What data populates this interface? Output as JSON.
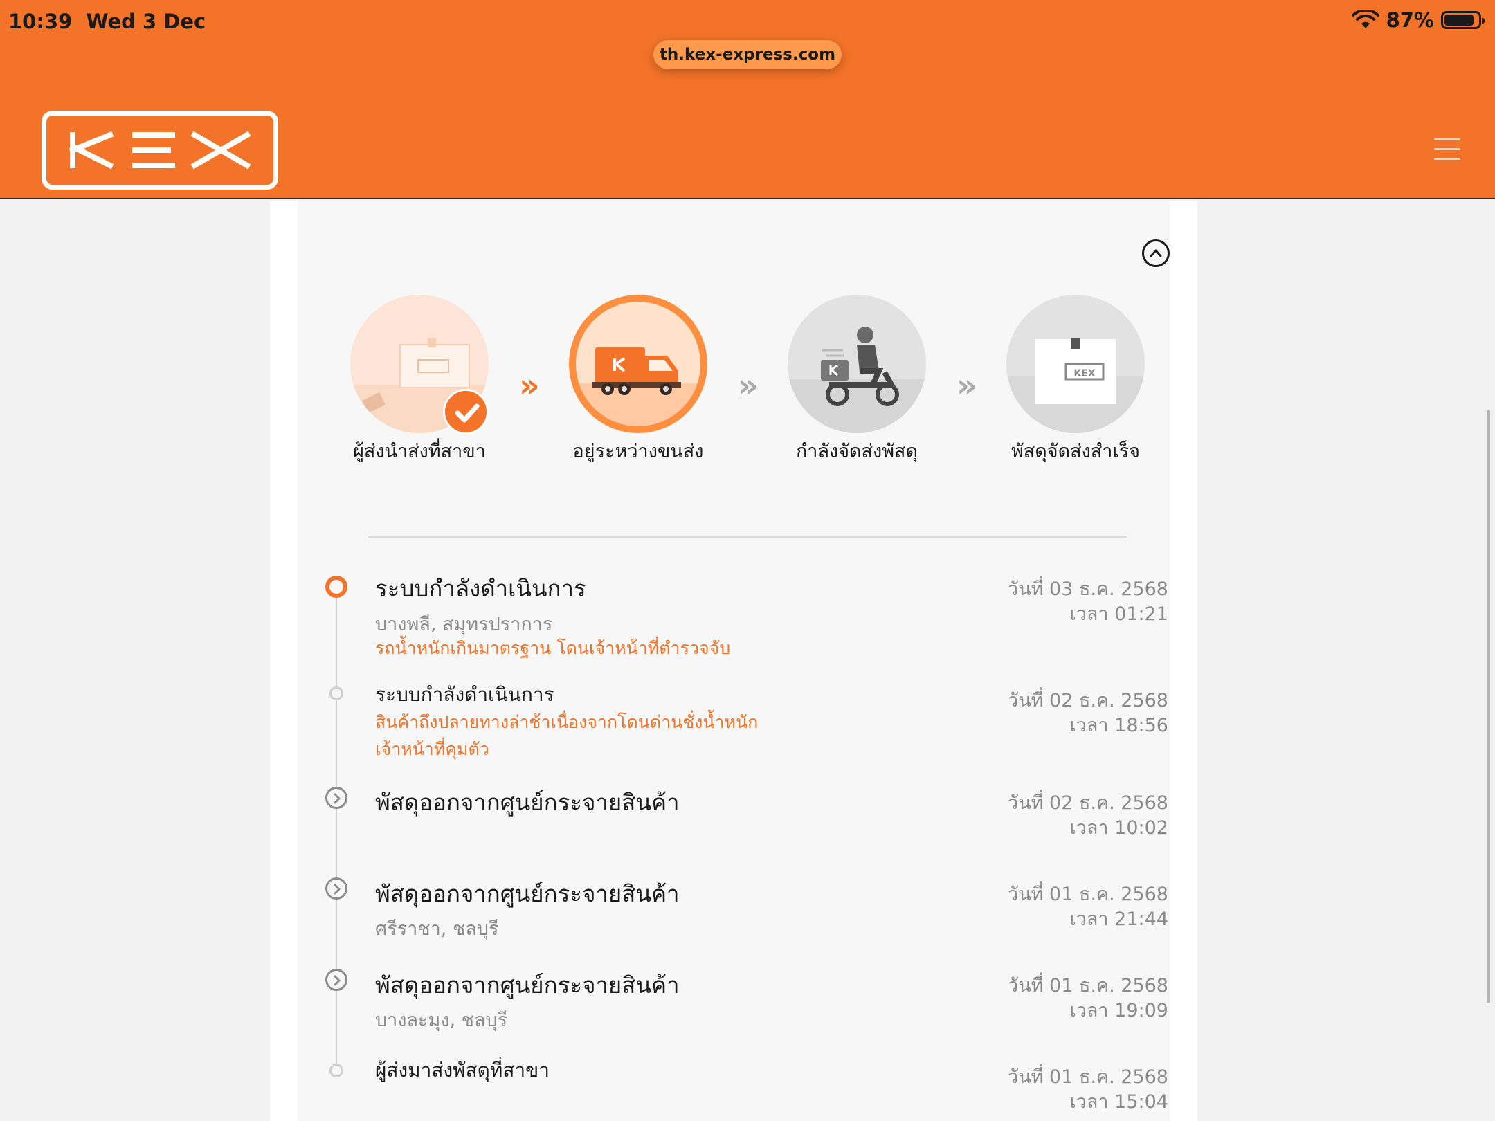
{
  "status_bar": {
    "time": "10:39",
    "date": "Wed 3 Dec",
    "battery": "87%",
    "battery_level": 0.87
  },
  "browser": {
    "url": "th.kex-express.com"
  },
  "brand": {
    "logo_text": "KEX",
    "accent_color": "#f37328"
  },
  "steps": [
    {
      "label": "ผู้ส่งนำส่งที่สาขา",
      "state": "done",
      "icon": "parcel-handover-icon"
    },
    {
      "label": "อยู่ระหว่างขนส่ง",
      "state": "active",
      "icon": "delivery-truck-icon"
    },
    {
      "label": "กำลังจัดส่งพัสดุ",
      "state": "pending",
      "icon": "courier-scooter-icon"
    },
    {
      "label": "พัสดุจัดส่งสำเร็จ",
      "state": "pending",
      "icon": "parcel-box-icon"
    }
  ],
  "timeline": [
    {
      "title": "ระบบกำลังดำเนินการ",
      "location": "บางพลี, สมุทรปราการ",
      "note": "รถน้ำหนักเกินมาตรฐาน โดนเจ้าหน้าที่ตำรวจจับ",
      "date": "วันที่ 03 ธ.ค. 2568",
      "time": "เวลา 01:21"
    },
    {
      "title": "ระบบกำลังดำเนินการ",
      "note": "สินค้าถึงปลายทางล่าช้าเนื่องจากโดนด่านชั่งน้ำหนัก เจ้าหน้าที่คุมตัว",
      "date": "วันที่ 02 ธ.ค. 2568",
      "time": "เวลา 18:56"
    },
    {
      "title": "พัสดุออกจากศูนย์กระจายสินค้า",
      "date": "วันที่ 02 ธ.ค. 2568",
      "time": "เวลา 10:02"
    },
    {
      "title": "พัสดุออกจากศูนย์กระจายสินค้า",
      "location": "ศรีราชา, ชลบุรี",
      "date": "วันที่ 01 ธ.ค. 2568",
      "time": "เวลา 21:44"
    },
    {
      "title": "พัสดุออกจากศูนย์กระจายสินค้า",
      "location": "บางละมุง, ชลบุรี",
      "date": "วันที่ 01 ธ.ค. 2568",
      "time": "เวลา 19:09"
    },
    {
      "title": "ผู้ส่งมาส่งพัสดุที่สาขา",
      "date": "วันที่ 01 ธ.ค. 2568",
      "time": "เวลา 15:04"
    }
  ]
}
